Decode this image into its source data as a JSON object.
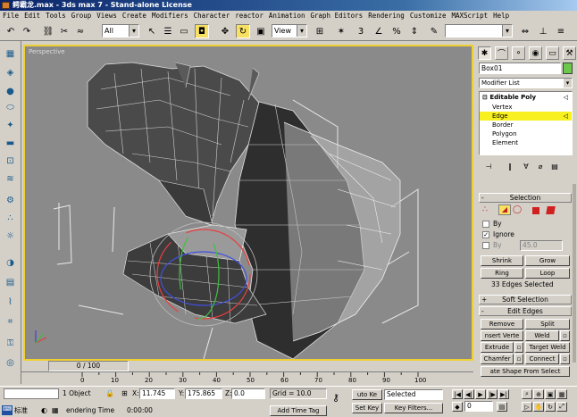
{
  "window": {
    "title": "鳄霸龙.max - 3ds max 7 - Stand-alone License"
  },
  "menu": [
    "File",
    "Edit",
    "Tools",
    "Group",
    "Views",
    "Create",
    "Modifiers",
    "Character",
    "reactor",
    "Animation",
    "Graph Editors",
    "Rendering",
    "Customize",
    "MAXScript",
    "Help"
  ],
  "toolbar": {
    "selection_filter": "All",
    "reference_coord": "View",
    "named_selection": ""
  },
  "viewport": {
    "label": "Perspective"
  },
  "command_panel": {
    "object_name": "Box01",
    "object_color": "#6ac84a",
    "modifier_list_label": "Modifier List",
    "stack": {
      "root": "Editable Poly",
      "items": [
        "Vertex",
        "Edge",
        "Border",
        "Polygon",
        "Element"
      ],
      "selected": "Edge"
    },
    "selection_rollout": {
      "title": "Selection",
      "by_label": "By",
      "ignore_label": "Ignore",
      "by_angle_label": "By",
      "angle_value": "45.0",
      "shrink": "Shrink",
      "grow": "Grow",
      "ring": "Ring",
      "loop": "Loop",
      "status": "33 Edges Selected"
    },
    "soft_selection_title": "Soft Selection",
    "edit_edges": {
      "title": "Edit Edges",
      "remove": "Remove",
      "split": "Split",
      "insert_vertex": "nsert Verte",
      "weld": "Weld",
      "extrude": "Extrude",
      "target_weld": "Target Weld",
      "chamfer": "Chamfer",
      "connect": "Connect",
      "create_shape": "ate Shape From Select"
    }
  },
  "timeline": {
    "slider": "0 / 100",
    "ticks": [
      "0",
      "10",
      "20",
      "30",
      "40",
      "50",
      "60",
      "70",
      "80",
      "90",
      "100"
    ]
  },
  "status": {
    "object_count": "1 Object",
    "x_label": "X:",
    "x_value": "11.745",
    "y_label": "Y:",
    "y_value": "175.865",
    "z_label": "Z:",
    "z_value": "0.0",
    "grid": "Grid = 10.0",
    "auto_key": "uto Ke",
    "set_key": "Set Key",
    "key_mode": "Selected",
    "key_filters": "Key Filters...",
    "frame": "0",
    "prompt": "endering Time",
    "render_time": "0:00:00",
    "add_time_tag": "Add Time Tag",
    "taskbar_label": "标准"
  }
}
